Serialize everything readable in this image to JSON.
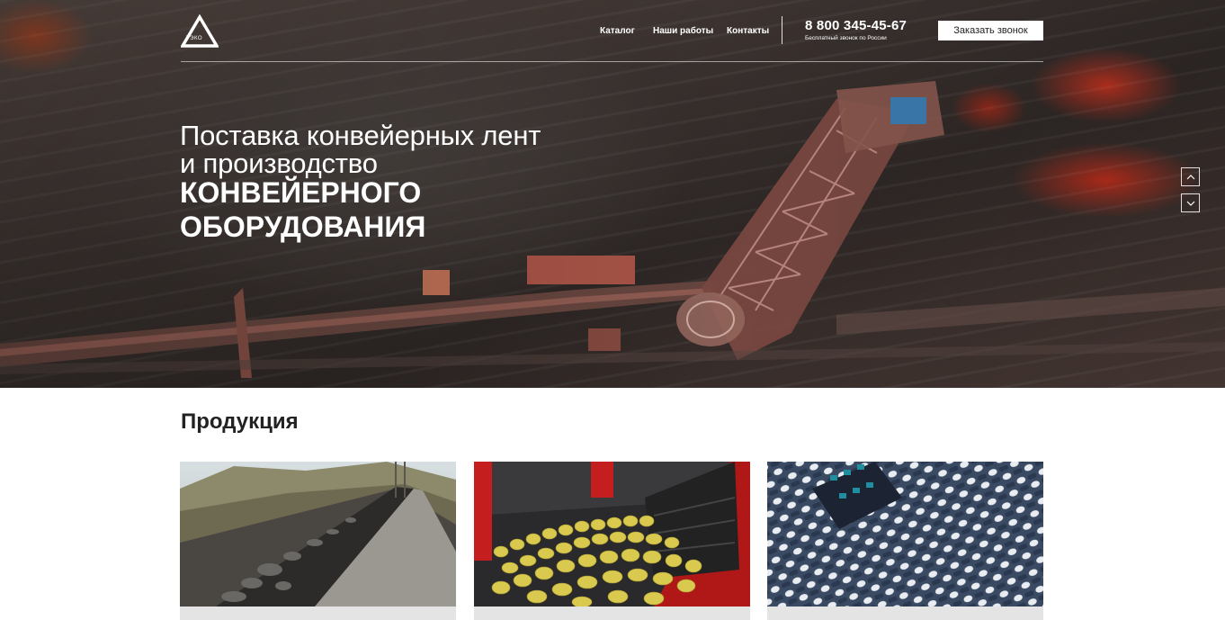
{
  "header": {
    "logo_text": "ТЭКО",
    "nav": {
      "catalog": "Каталог",
      "works": "Наши работы",
      "contacts": "Контакты"
    },
    "phone": "8 800 345-45-67",
    "phone_note": "Бесплатный звонок по России",
    "call_button": "Заказать звонок"
  },
  "hero": {
    "line1": "Поставка конвейерных лент",
    "line2": "и производство",
    "bold1": "КОНВЕЙЕРНОГО",
    "bold2": "ОБОРУДОВАНИЯ",
    "slider_up_icon": "chevron-up-icon",
    "slider_down_icon": "chevron-down-icon"
  },
  "products": {
    "title": "Продукция",
    "cards": [
      {
        "image": "mining-conveyor-belt-photo"
      },
      {
        "image": "potato-conveyor-photo"
      },
      {
        "image": "modular-plastic-belt-photo"
      }
    ]
  },
  "colors": {
    "accent_red": "#c8321e",
    "white": "#ffffff",
    "text_dark": "#222222",
    "card_footer": "#e4e4e4"
  }
}
